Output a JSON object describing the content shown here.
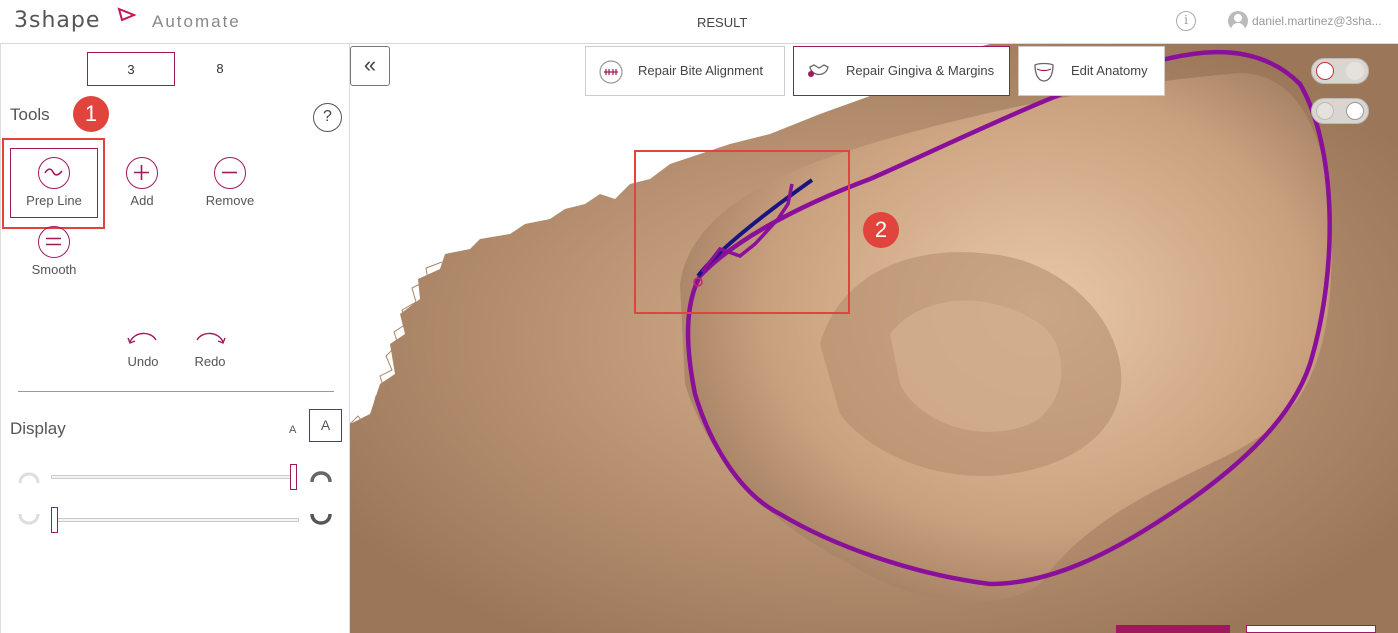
{
  "header": {
    "logo_text": "3shape",
    "app_name": "Automate",
    "title": "RESULT",
    "user": "daniel.martinez@3sha..."
  },
  "teeth_tabs": [
    {
      "label": "3",
      "active": true
    },
    {
      "label": "8",
      "active": false
    }
  ],
  "tools": {
    "title": "Tools",
    "help": "?",
    "items": [
      {
        "label": "Prep Line",
        "icon": "prep-line-icon",
        "selected": true
      },
      {
        "label": "Add",
        "icon": "plus-icon",
        "selected": false
      },
      {
        "label": "Remove",
        "icon": "minus-icon",
        "selected": false
      },
      {
        "label": "Smooth",
        "icon": "equals-icon",
        "selected": false
      }
    ],
    "undo": "Undo",
    "redo": "Redo"
  },
  "display": {
    "title": "Display",
    "font_small": "A",
    "font_large": "A",
    "upper_jaw_transparency": 1.0,
    "lower_jaw_transparency": 0.0
  },
  "viewport_buttons": [
    {
      "label": "Repair Bite Alignment",
      "icon": "bite-icon",
      "active": false
    },
    {
      "label": "Repair Gingiva & Margins",
      "icon": "gingiva-icon",
      "active": true
    },
    {
      "label": "Edit Anatomy",
      "icon": "tooth-icon",
      "active": false
    }
  ],
  "annotations": [
    "1",
    "2"
  ],
  "colors": {
    "accent": "#a0195c",
    "annotation": "#e0443c",
    "model": "#c49b78",
    "margin_line": "#8a0f9a",
    "edited_line": "#1a1480"
  }
}
